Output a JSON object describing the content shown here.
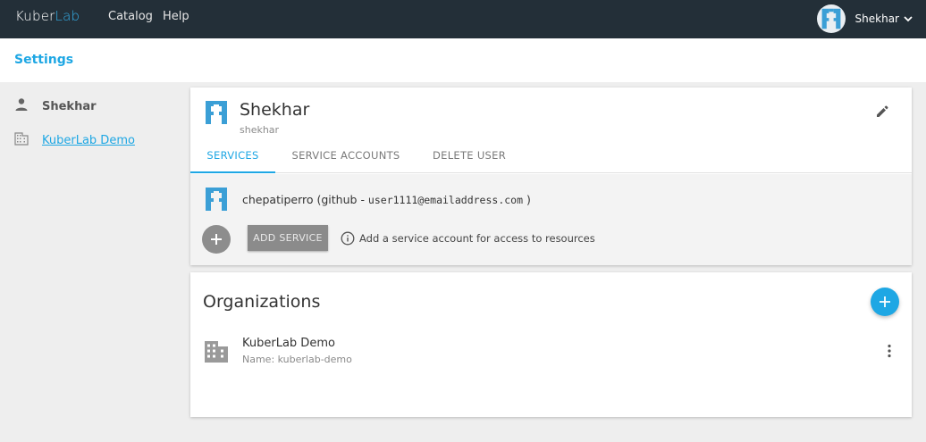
{
  "app": {
    "logo_part1": "Kuber",
    "logo_part2": "Lab"
  },
  "nav": {
    "catalog": "Catalog",
    "help": "Help"
  },
  "user_menu": {
    "name": "Shekhar"
  },
  "page": {
    "title": "Settings"
  },
  "sidebar": {
    "items": [
      {
        "label": "Shekhar",
        "icon": "person-icon"
      },
      {
        "label": "KuberLab Demo",
        "icon": "building-icon"
      }
    ]
  },
  "profile": {
    "display_name": "Shekhar",
    "username": "shekhar",
    "tabs": [
      {
        "label": "SERVICES",
        "active": true
      },
      {
        "label": "SERVICE ACCOUNTS",
        "active": false
      },
      {
        "label": "DELETE USER",
        "active": false
      }
    ]
  },
  "services": {
    "account_name": "chepatiperro",
    "provider_prefix": "(github - ",
    "email": "user1111@emailaddress.com",
    "provider_suffix": " )",
    "add_button": "ADD SERVICE",
    "hint": "Add a service account for access to resources"
  },
  "organizations": {
    "title": "Organizations",
    "items": [
      {
        "name": "KuberLab Demo",
        "sub": "Name: kuberlab-demo"
      }
    ]
  },
  "colors": {
    "accent": "#1ea7e4",
    "topbar": "#232f38",
    "logo_lab": "#34aee8"
  }
}
